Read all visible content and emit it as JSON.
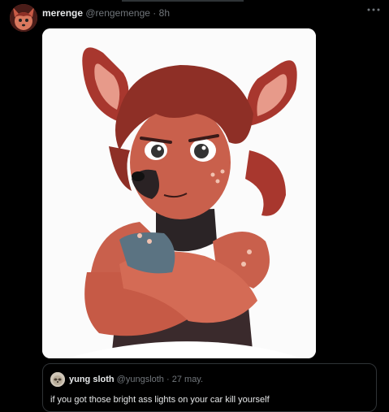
{
  "tweet": {
    "display_name": "merenge",
    "handle": "@rengemenge",
    "separator": "·",
    "time": "8h",
    "more_icon": "more-horizontal-icon",
    "media_description": "artwork"
  },
  "quoted_tweet": {
    "display_name": "yung sloth",
    "handle": "@yungsloth",
    "separator": "·",
    "time": "27 may.",
    "text": "if you got those bright ass lights on your car kill yourself"
  },
  "colors": {
    "background": "#000000",
    "text_primary": "#e7e9ea",
    "text_secondary": "#71767b",
    "border": "#2f3336"
  }
}
